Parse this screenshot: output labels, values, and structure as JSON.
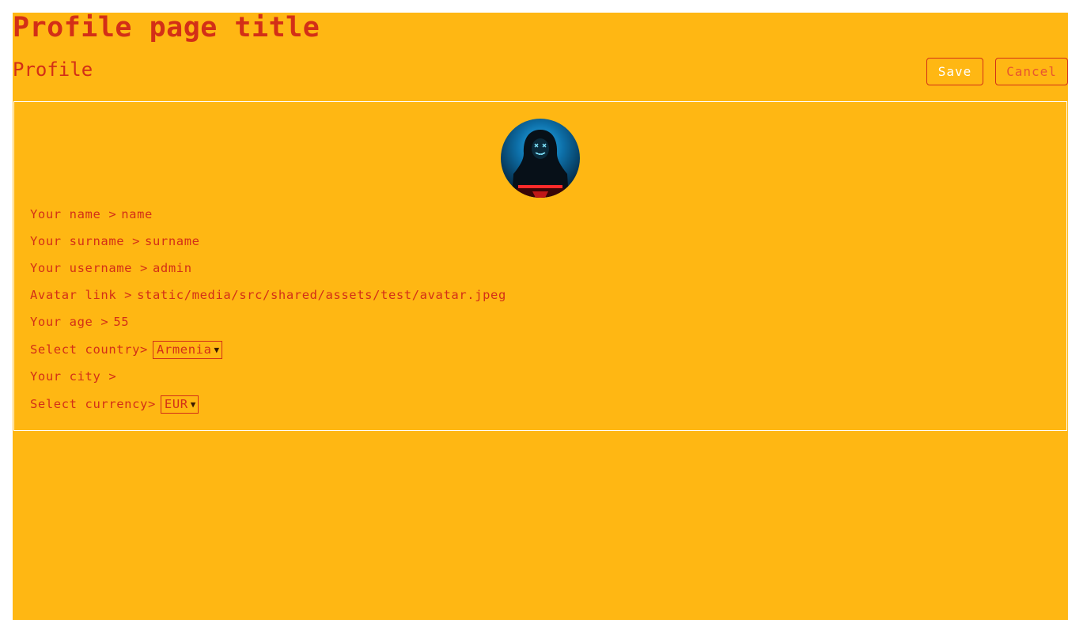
{
  "page": {
    "title": "Profile page title"
  },
  "header": {
    "heading": "Profile",
    "save_label": "Save",
    "cancel_label": "Cancel"
  },
  "profile": {
    "name": {
      "label": "Your name >",
      "value": "name"
    },
    "surname": {
      "label": "Your surname >",
      "value": "surname"
    },
    "username": {
      "label": "Your username >",
      "value": "admin"
    },
    "avatar": {
      "label": "Avatar link >",
      "value": "static/media/src/shared/assets/test/avatar.jpeg"
    },
    "age": {
      "label": "Your age >",
      "value": "55"
    },
    "country": {
      "label": "Select country>",
      "selected": "Armenia"
    },
    "city": {
      "label": "Your city >",
      "value": ""
    },
    "currency": {
      "label": "Select currency>",
      "selected": "EUR"
    }
  },
  "colors": {
    "background": "#ffb713",
    "text": "#d32f17",
    "save_text": "#ffffff",
    "cancel_text": "#e8552f"
  },
  "icons": {
    "avatar": "hooded-figure-avatar-icon",
    "select_arrow": "chevron-down-icon"
  }
}
